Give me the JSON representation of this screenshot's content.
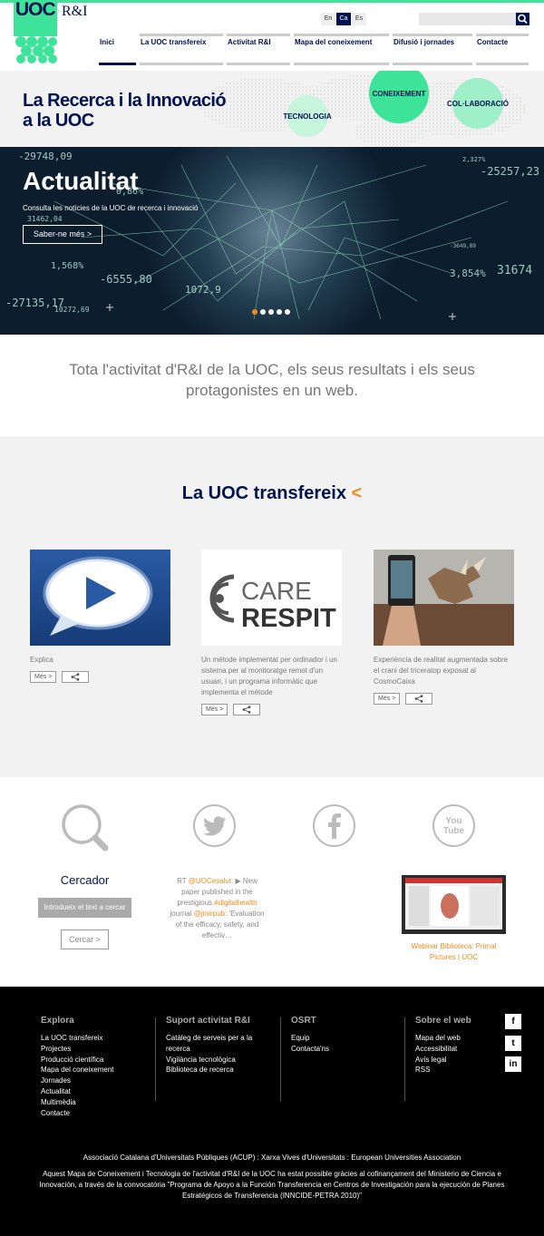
{
  "header": {
    "logo_text": "UOC",
    "logo_suffix": "R&I",
    "languages": [
      "En",
      "Ca",
      "Es"
    ],
    "active_language": "Ca",
    "search_placeholder": "",
    "nav": [
      "Inici",
      "La UOC transfereix",
      "Activitat R&I",
      "Mapa del coneixement",
      "Difusió i jornades",
      "Contacte"
    ]
  },
  "banner": {
    "title_line1": "La Recerca i la Innovació",
    "title_line2": "a la UOC",
    "bubbles": [
      "TECNOLOGIA",
      "CONEIXEMENT",
      "COL·LABORACIÓ"
    ]
  },
  "hero": {
    "title": "Actualitat",
    "subtitle": "Consulta les notícies de la UOC de recerca i innovació",
    "button": "Saber-ne més >",
    "numbers": [
      "-29748,09",
      "-25257,23",
      "31462,04",
      "1,568%",
      "-6555,80",
      "31674",
      "-27135,17",
      "3,854%",
      "1072,9",
      "10272,69",
      "2,327%",
      "0,86%",
      "-3649,89"
    ],
    "slides": 5,
    "active_slide": 0
  },
  "intro": {
    "line1": "Tota l'activitat d'R&I de la UOC, els seus resultats i els seus",
    "line2": "protagonistes en un web."
  },
  "transfer": {
    "title": "La UOC transfereix",
    "arrow": "<",
    "more_label": "Més >",
    "care_line1": "CARE",
    "care_line2": "RESPIT",
    "cards": [
      {
        "text": "Explica"
      },
      {
        "text": "Un mètode implementat per ordinador i un sistema per al monitoratge remot d'un usuari, i un programa informàtic que implementa el mètode"
      },
      {
        "text": "Experiència de realitat augmentada sobre el crani del triceratop exposat al CosmoCaixa"
      }
    ]
  },
  "social": {
    "search_title": "Cercador",
    "search_placeholder": "Introdueix el text a cercar",
    "search_button": "Cercar >",
    "tweet": {
      "prefix": "RT ",
      "handle": "@UOCesalut",
      "text1": ": ▶ New paper published in the prestigious ",
      "hashtag": "#digitalhealth",
      "text2": " journal ",
      "handle2": "@jmirpub",
      "text3": ": 'Evaluation of the efficacy, safety, and effectiv…"
    },
    "youtube_label": "You Tube",
    "video_caption": "Webinar Biblioteca: Primal Pictures | UOC"
  },
  "footer": {
    "columns": [
      {
        "title": "Explora",
        "links": [
          "La UOC transfereix",
          "Projectes",
          "Producció científica",
          "Mapa del coneixement",
          "Jornades",
          "Actualitat",
          "Multimèdia",
          "Contacte"
        ]
      },
      {
        "title": "Suport activitat R&I",
        "links": [
          "Catàleg de serveis per a la recerca",
          "Vigilància tecnològica",
          "Biblioteca de recerca"
        ]
      },
      {
        "title": "OSRT",
        "links": [
          "Equip",
          "Contacta'ns"
        ]
      },
      {
        "title": "Sobre el web",
        "links": [
          "Mapa del web",
          "Accessibilitat",
          "Avís legal",
          "RSS"
        ]
      }
    ],
    "social_icons": [
      "f",
      "t",
      "in"
    ],
    "legal": "Associació Catalana d'Universitats Públiques (ACUP) : Xarxa Vives d'Universitats : European Universities Association",
    "note": "Aquest Mapa de Coneixement i Tecnologia de l'activitat d'R&I de la UOC ha estat possible gràcies al cofinançament del Ministerio de Ciencia e Innovación, a través de la convocatòria \"Programa de Apoyo a la Función Transferencia en Centros de Investigación para la ejecución de Planes Estratégicos de Transferencia (INNCIDE-PETRA 2010)\""
  },
  "colors": {
    "brand_navy": "#00124f",
    "accent_green": "#3ee39a",
    "accent_orange": "#f08c1e"
  }
}
